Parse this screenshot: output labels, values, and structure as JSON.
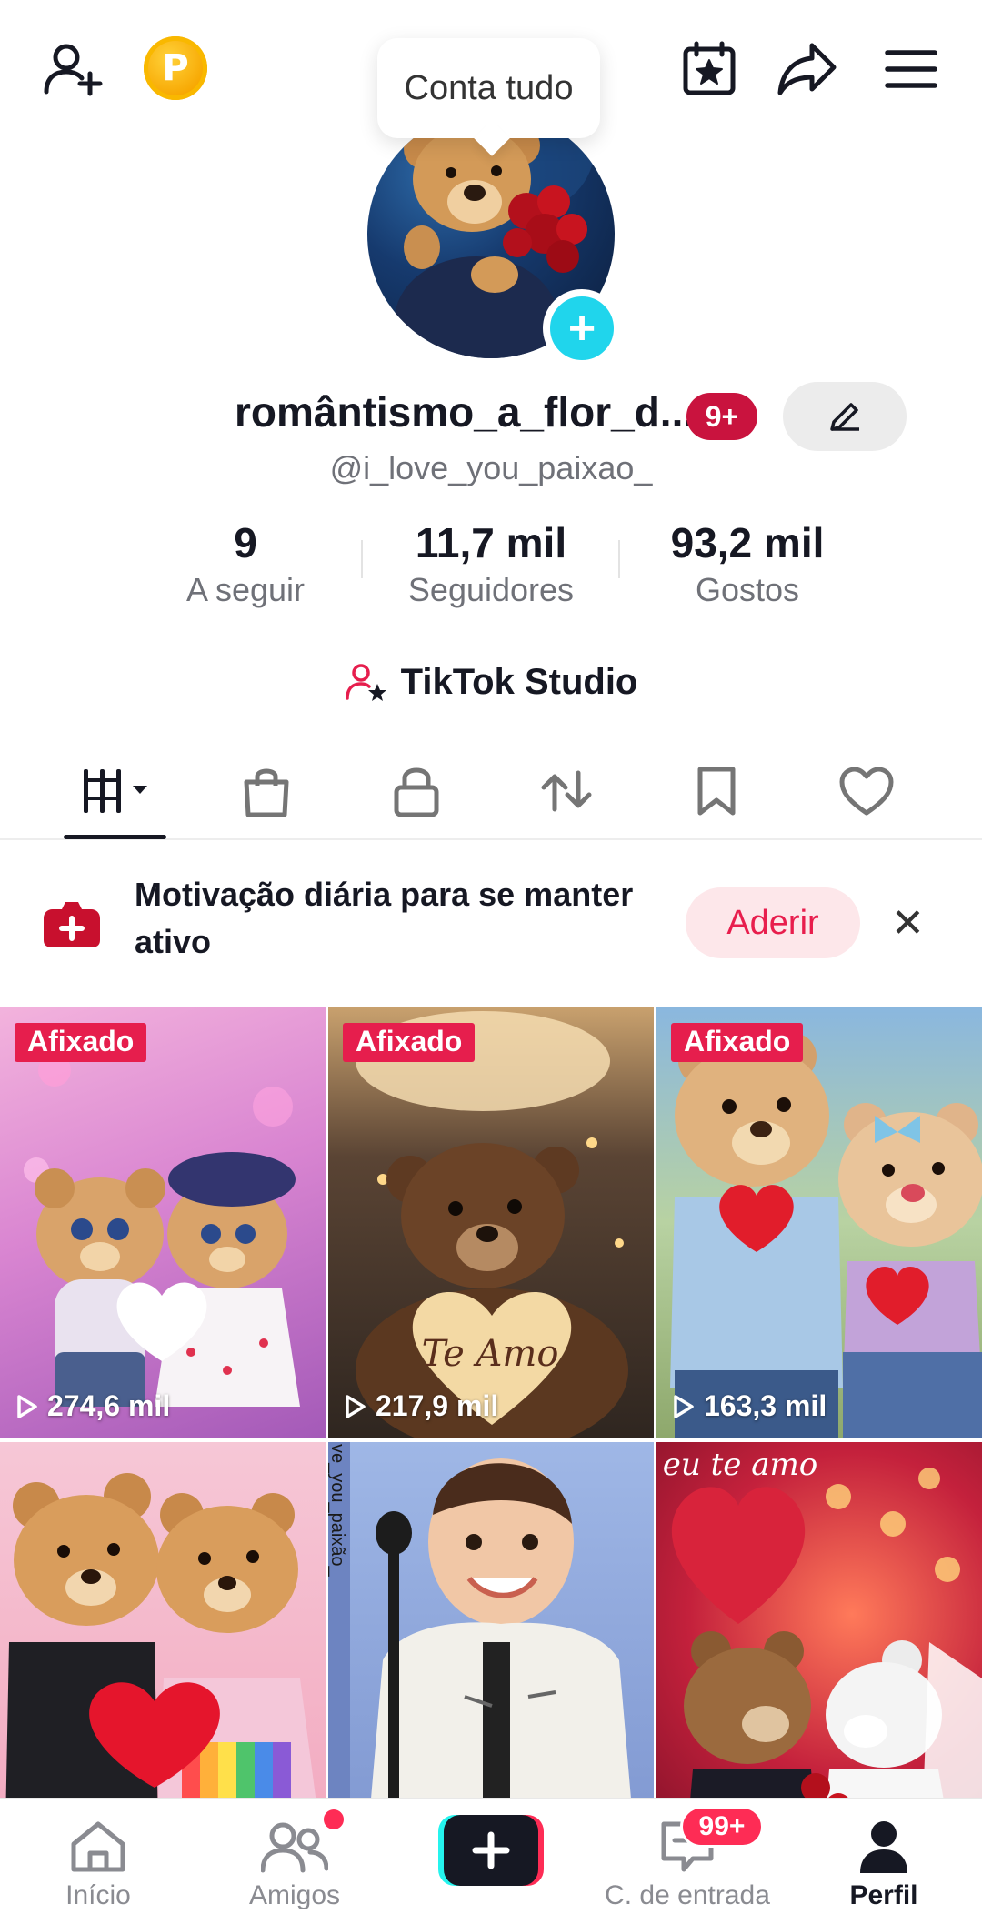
{
  "header": {
    "tooltip": "Conta tudo",
    "points_badge": "P",
    "icons": [
      "add-friend-icon",
      "calendar-star-icon",
      "share-icon",
      "menu-icon"
    ]
  },
  "profile": {
    "username": "romântismo_a_flor_d...",
    "notifications": "9+",
    "handle": "@i_love_you_paixao_"
  },
  "stats": [
    {
      "value": "9",
      "label": "A seguir"
    },
    {
      "value": "11,7 mil",
      "label": "Seguidores"
    },
    {
      "value": "93,2 mil",
      "label": "Gostos"
    }
  ],
  "studio_label": "TikTok Studio",
  "tabs": [
    "videos-grid-icon",
    "shop-bag-icon",
    "lock-icon",
    "repost-icon",
    "bookmark-icon",
    "heart-icon"
  ],
  "promo": {
    "text": "Motivação diária para se manter ativo",
    "button": "Aderir"
  },
  "videos": [
    {
      "pinned": "Afixado",
      "views": "274,6 mil",
      "art_text": ""
    },
    {
      "pinned": "Afixado",
      "views": "217,9 mil",
      "art_text": "Te Amo"
    },
    {
      "pinned": "Afixado",
      "views": "163,3 mil",
      "art_text": ""
    },
    {
      "pinned": "",
      "views": "",
      "art_text": ""
    },
    {
      "pinned": "",
      "views": "",
      "art_text": "ve_you_paixão_"
    },
    {
      "pinned": "",
      "views": "",
      "art_text": "eu te amo"
    }
  ],
  "nav": {
    "home": "Início",
    "friends": "Amigos",
    "inbox": "C. de entrada",
    "inbox_badge": "99+",
    "profile": "Perfil"
  },
  "colors": {
    "accent": "#fe2c55",
    "pin_red": "#e61e4d",
    "cyan": "#20d5ec"
  }
}
